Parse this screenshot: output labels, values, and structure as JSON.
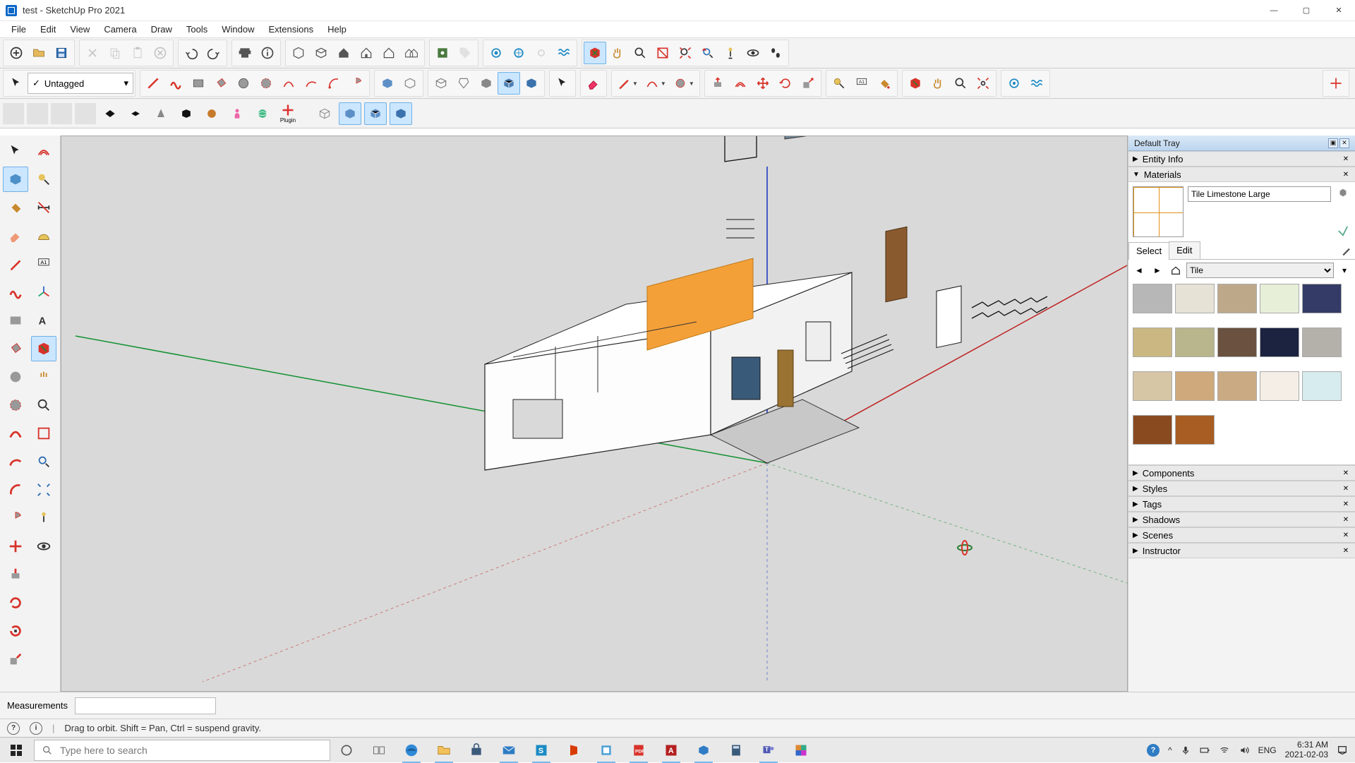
{
  "window": {
    "title": "test - SketchUp Pro 2021",
    "buttons": {
      "min": "—",
      "max": "▢",
      "close": "✕"
    }
  },
  "menu": [
    "File",
    "Edit",
    "View",
    "Camera",
    "Draw",
    "Tools",
    "Window",
    "Extensions",
    "Help"
  ],
  "tag_selector": {
    "check": "✓",
    "value": "Untagged"
  },
  "row3_plugin_label": "Plugin",
  "tray": {
    "title": "Default Tray",
    "panels": [
      "Entity Info",
      "Materials",
      "Components",
      "Styles",
      "Tags",
      "Shadows",
      "Scenes",
      "Instructor"
    ],
    "materials": {
      "name": "Tile Limestone Large",
      "tabs": {
        "select": "Select",
        "edit": "Edit"
      },
      "collection": "Tile",
      "swatch_colors": [
        "#b7b7b7",
        "#e6e2d6",
        "#bda98a",
        "#e7efd9",
        "#333b66",
        "#cbb782",
        "#b9b58c",
        "#6a5140",
        "#1b2340",
        "#b4b0aa",
        "#d6c6a6",
        "#cfa97b",
        "#c9aa82",
        "#f4eee6",
        "#d7ecef",
        "#8a4a20",
        "#a85d22"
      ]
    }
  },
  "measurements_label": "Measurements",
  "status": {
    "hint": "Drag to orbit. Shift = Pan, Ctrl = suspend gravity."
  },
  "taskbar": {
    "search_placeholder": "Type here to search",
    "lang": "ENG",
    "time": "6:31 AM",
    "date": "2021-02-03"
  }
}
